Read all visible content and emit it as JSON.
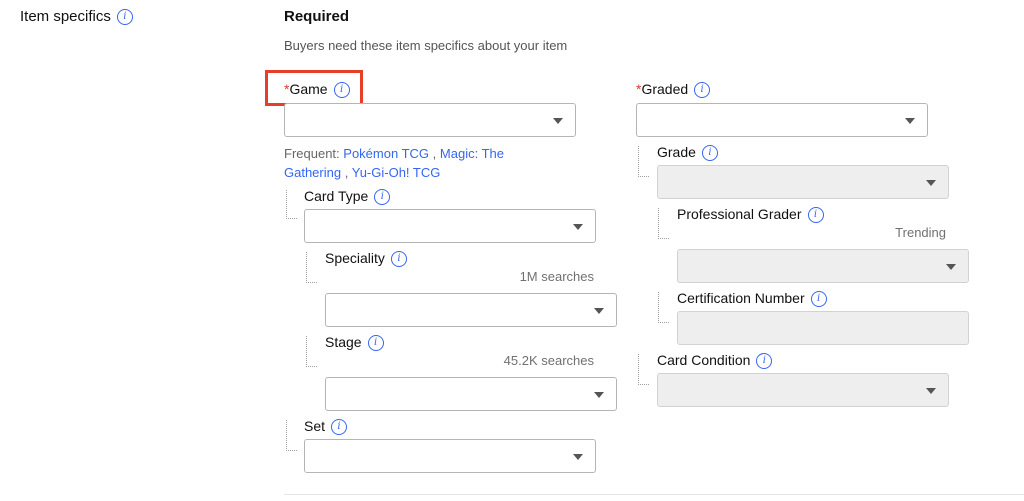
{
  "section": {
    "title": "Item specifics",
    "required_heading": "Required",
    "required_sub": "Buyers need these item specifics about your item"
  },
  "fields": {
    "game": {
      "req": "*",
      "label": "Game"
    },
    "frequent": {
      "prefix": "Frequent:",
      "opt1": "Pokémon TCG",
      "sep1": ",",
      "opt2": "Magic: The Gathering",
      "sep2": ",",
      "opt3": "Yu-Gi-Oh! TCG"
    },
    "card_type": {
      "label": "Card Type"
    },
    "speciality": {
      "label": "Speciality",
      "meta": "1M searches"
    },
    "stage": {
      "label": "Stage",
      "meta": "45.2K searches"
    },
    "set": {
      "label": "Set"
    },
    "graded": {
      "req": "*",
      "label": "Graded"
    },
    "grade": {
      "label": "Grade"
    },
    "professional_grader": {
      "label": "Professional Grader",
      "meta": "Trending"
    },
    "certification_number": {
      "label": "Certification Number"
    },
    "card_condition": {
      "label": "Card Condition"
    }
  },
  "colors": {
    "accent": "#3665f3",
    "required_star": "#e0362c",
    "highlight_box": "#e53f2a"
  },
  "icons": {
    "info": "info-icon",
    "dropdown": "chevron-down-icon"
  }
}
